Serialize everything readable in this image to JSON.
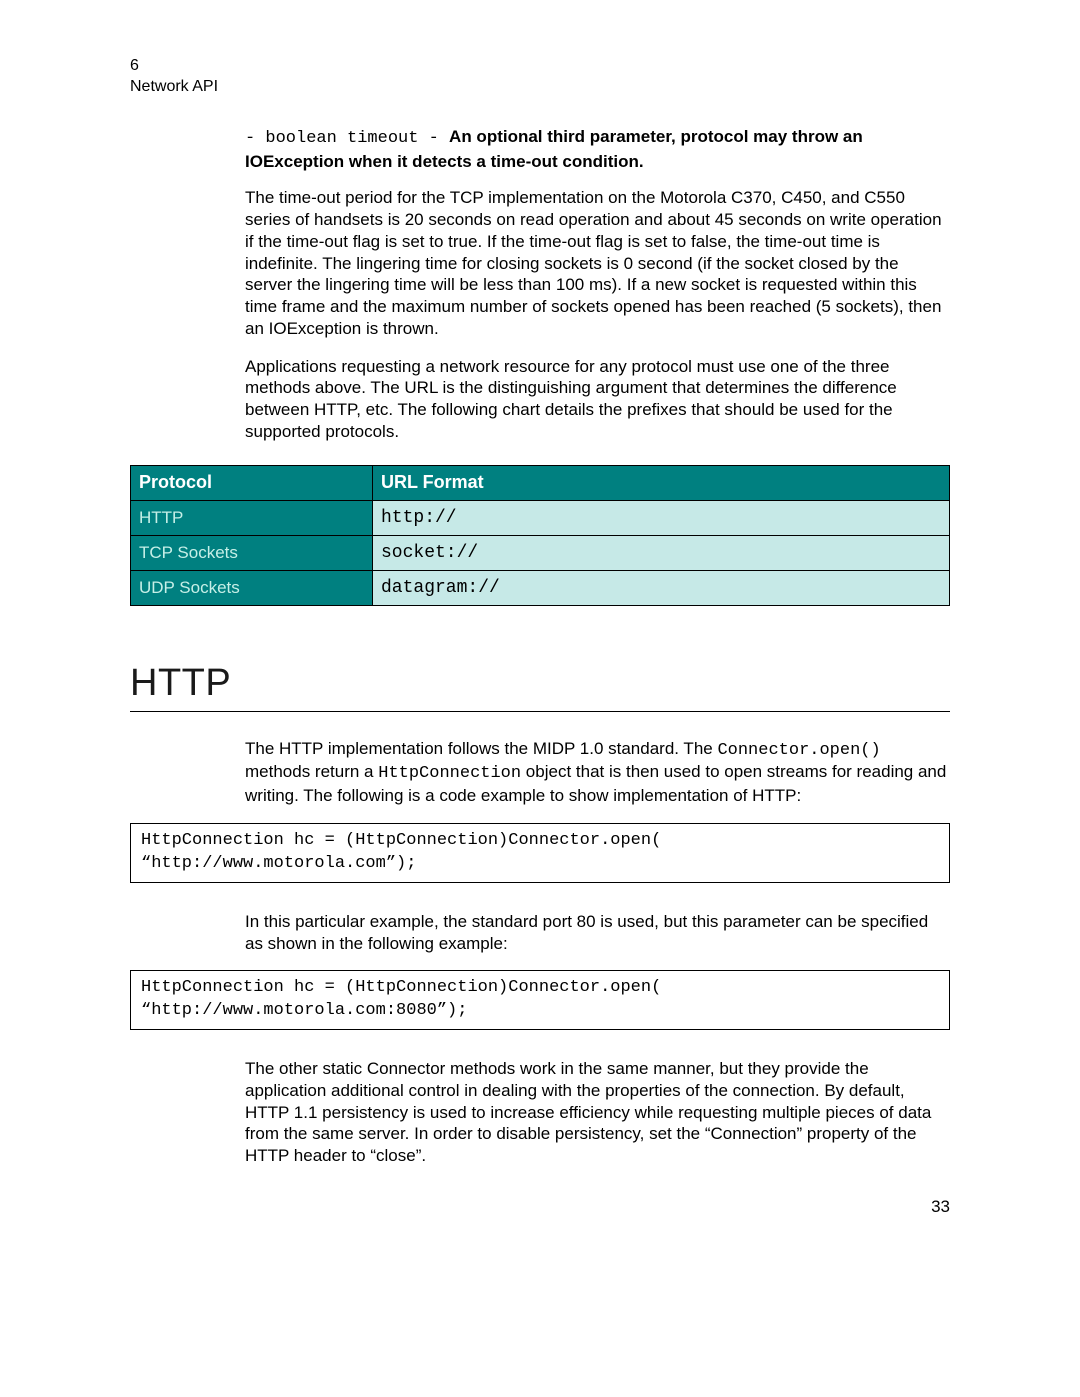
{
  "header": {
    "chapter_num": "6",
    "chapter_title": "Network API"
  },
  "bullet": {
    "dash1": "- ",
    "code": "boolean timeout",
    "dash2": " -  ",
    "bold": "An optional third parameter,  protocol may throw an IOException when it detects a time-out condition."
  },
  "para1": "The time-out period for the TCP implementation on the Motorola C370, C450, and C550 series of handsets is 20 seconds on read operation and about 45 seconds on write operation if the time-out flag is set to true. If the time-out flag is set to false, the time-out time is indefinite. The lingering time for closing sockets is 0 second (if the socket closed by the server the lingering time will be less than 100 ms). If a new socket is requested within this time frame and the maximum number of sockets opened has been reached (5 sockets), then an IOException is thrown.",
  "para2": "Applications requesting a network resource for any protocol must use one of the three methods above. The URL is the distinguishing argument that determines the difference between HTTP, etc.  The following chart details the prefixes that should be used for the supported protocols.",
  "table": {
    "head": {
      "c1": "Protocol",
      "c2": "URL Format"
    },
    "rows": [
      {
        "c1": "HTTP",
        "c2": "http://"
      },
      {
        "c1": "TCP Sockets",
        "c2": "socket://"
      },
      {
        "c1": "UDP Sockets",
        "c2": "datagram://"
      }
    ]
  },
  "h1": "HTTP",
  "http_intro": {
    "t1": "The HTTP implementation follows the MIDP 1.0 standard. The ",
    "code1": "Connector.open()",
    "t2": " methods return a ",
    "code2": "HttpConnection",
    "t3": " object that is then used to open streams for reading and writing.  The following is a code example to show implementation of HTTP:"
  },
  "code1": "HttpConnection hc = (HttpConnection)Connector.open( “http://www.motorola.com”);",
  "para3": "In this particular example, the standard port 80 is used, but this parameter can be specified as shown in the following example:",
  "code2": "HttpConnection hc = (HttpConnection)Connector.open( “http://www.motorola.com:8080”);",
  "para4": "The other static Connector methods work in the same manner, but they provide the application additional control in dealing with the properties of the connection.  By default, HTTP 1.1 persistency is used to increase efficiency while requesting multiple pieces of data from the same server.  In order to disable persistency, set the “Connection” property of the HTTP header to “close”.",
  "page_num": "33"
}
